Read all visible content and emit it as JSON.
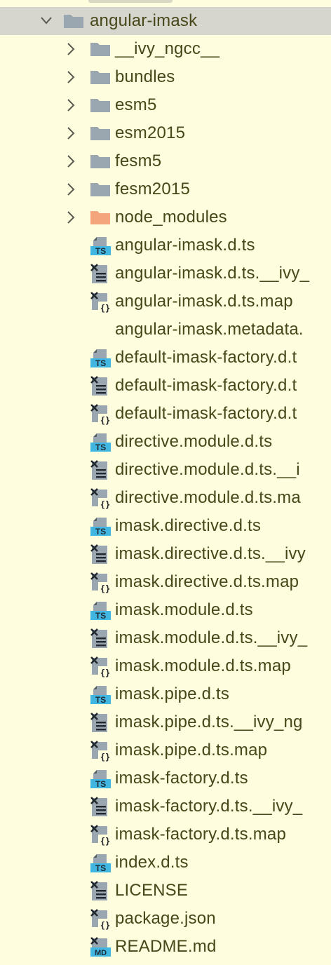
{
  "tree": [
    {
      "label": "angular-imask",
      "icon": "folder-icon",
      "chevron": "open",
      "depth": 0,
      "selected": true
    },
    {
      "label": "__ivy_ngcc__",
      "icon": "folder-icon",
      "chevron": "closed",
      "depth": 1
    },
    {
      "label": "bundles",
      "icon": "folder-icon",
      "chevron": "closed",
      "depth": 1
    },
    {
      "label": "esm5",
      "icon": "folder-icon",
      "chevron": "closed",
      "depth": 1
    },
    {
      "label": "esm2015",
      "icon": "folder-icon",
      "chevron": "closed",
      "depth": 1
    },
    {
      "label": "fesm5",
      "icon": "folder-icon",
      "chevron": "closed",
      "depth": 1
    },
    {
      "label": "fesm2015",
      "icon": "folder-icon",
      "chevron": "closed",
      "depth": 1
    },
    {
      "label": "node_modules",
      "icon": "excluded-folder-icon",
      "chevron": "closed",
      "depth": 1
    },
    {
      "label": "angular-imask.d.ts",
      "icon": "typescript-file-icon",
      "depth": 1
    },
    {
      "label": "angular-imask.d.ts.__ivy_",
      "icon": "text-file-icon",
      "depth": 1
    },
    {
      "label": "angular-imask.d.ts.map",
      "icon": "json-file-icon",
      "depth": 1
    },
    {
      "label": "angular-imask.metadata.",
      "icon": "none",
      "depth": 1
    },
    {
      "label": "default-imask-factory.d.t",
      "icon": "typescript-file-icon",
      "depth": 1
    },
    {
      "label": "default-imask-factory.d.t",
      "icon": "text-file-icon",
      "depth": 1
    },
    {
      "label": "default-imask-factory.d.t",
      "icon": "json-file-icon",
      "depth": 1
    },
    {
      "label": "directive.module.d.ts",
      "icon": "typescript-file-icon",
      "depth": 1
    },
    {
      "label": "directive.module.d.ts.__i",
      "icon": "text-file-icon",
      "depth": 1
    },
    {
      "label": "directive.module.d.ts.ma",
      "icon": "json-file-icon",
      "depth": 1
    },
    {
      "label": "imask.directive.d.ts",
      "icon": "typescript-file-icon",
      "depth": 1
    },
    {
      "label": "imask.directive.d.ts.__ivy",
      "icon": "text-file-icon",
      "depth": 1
    },
    {
      "label": "imask.directive.d.ts.map",
      "icon": "json-file-icon",
      "depth": 1
    },
    {
      "label": "imask.module.d.ts",
      "icon": "typescript-file-icon",
      "depth": 1
    },
    {
      "label": "imask.module.d.ts.__ivy_",
      "icon": "text-file-icon",
      "depth": 1
    },
    {
      "label": "imask.module.d.ts.map",
      "icon": "json-file-icon",
      "depth": 1
    },
    {
      "label": "imask.pipe.d.ts",
      "icon": "typescript-file-icon",
      "depth": 1
    },
    {
      "label": "imask.pipe.d.ts.__ivy_ng",
      "icon": "text-file-icon",
      "depth": 1
    },
    {
      "label": "imask.pipe.d.ts.map",
      "icon": "json-file-icon",
      "depth": 1
    },
    {
      "label": "imask-factory.d.ts",
      "icon": "typescript-file-icon",
      "depth": 1
    },
    {
      "label": "imask-factory.d.ts.__ivy_",
      "icon": "text-file-icon",
      "depth": 1
    },
    {
      "label": "imask-factory.d.ts.map",
      "icon": "json-file-icon",
      "depth": 1
    },
    {
      "label": "index.d.ts",
      "icon": "typescript-file-icon",
      "depth": 1
    },
    {
      "label": "LICENSE",
      "icon": "text-file-icon",
      "depth": 1
    },
    {
      "label": "package.json",
      "icon": "json-file-icon",
      "depth": 1
    },
    {
      "label": "README.md",
      "icon": "markdown-file-icon",
      "depth": 1
    }
  ],
  "icon_text": {
    "ts": "TS",
    "md": "MD",
    "json": "{}"
  },
  "colors": {
    "background": "#fefedf",
    "selected_row": "#d6d6ce",
    "text": "#48471a",
    "folder": "#9aa7b0",
    "excluded_folder": "#f4a57c",
    "ts_badge": "#40b6e0",
    "doc_gray": "#9aa7b0",
    "doc_dark": "#23282d"
  }
}
